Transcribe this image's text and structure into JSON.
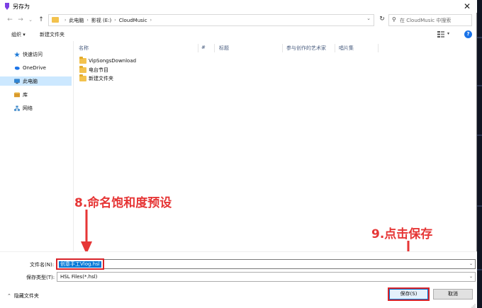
{
  "window": {
    "title": "另存为",
    "close_glyph": "✕"
  },
  "nav": {
    "back_glyph": "←",
    "forward_glyph": "→",
    "dropdown_glyph": "⌄",
    "up_glyph": "↑",
    "breadcrumb": [
      "此电脑",
      "影视 (E:)",
      "CloudMusic"
    ],
    "crumb_sep": "›",
    "address_dropdown_glyph": "⌄",
    "refresh_glyph": "↻",
    "search_placeholder": "在 CloudMusic 中搜索",
    "search_glyph": "⚲"
  },
  "toolbar": {
    "organize_label": "组织 ▾",
    "new_folder_label": "新建文件夹",
    "view_dd_glyph": "▾",
    "help_glyph": "?"
  },
  "sidebar": {
    "items": [
      {
        "label": "快速访问",
        "icon": "star-icon",
        "color": "#1f7bd8"
      },
      {
        "label": "OneDrive",
        "icon": "cloud-icon",
        "color": "#1a73e8"
      },
      {
        "label": "此电脑",
        "icon": "computer-icon",
        "color": "#2f86d6",
        "selected": true
      },
      {
        "label": "库",
        "icon": "library-icon",
        "color": "#d99a2b"
      },
      {
        "label": "网络",
        "icon": "network-icon",
        "color": "#3b87c9"
      }
    ]
  },
  "file_list": {
    "columns": [
      "名称",
      "#",
      "标题",
      "参与创作的艺术家",
      "唱片集"
    ],
    "rows": [
      {
        "name": "VipSongsDownload"
      },
      {
        "name": "电台节目"
      },
      {
        "name": "新建文件夹"
      }
    ]
  },
  "save_form": {
    "filename_label": "文件名(N):",
    "filename_value": "创意手工Vlog.hsl",
    "filetype_label": "保存类型(T):",
    "filetype_value": "HSL Files(*.hsl)",
    "dropdown_glyph": "⌄"
  },
  "footer": {
    "hide_folders_label": "隐藏文件夹",
    "hide_folders_glyph": "⌃",
    "save_button": "保存(S)",
    "cancel_button": "取消"
  },
  "annotations": {
    "step8": "8.命名饱和度预设",
    "step9": "9.点击保存",
    "color": "#e63636"
  }
}
